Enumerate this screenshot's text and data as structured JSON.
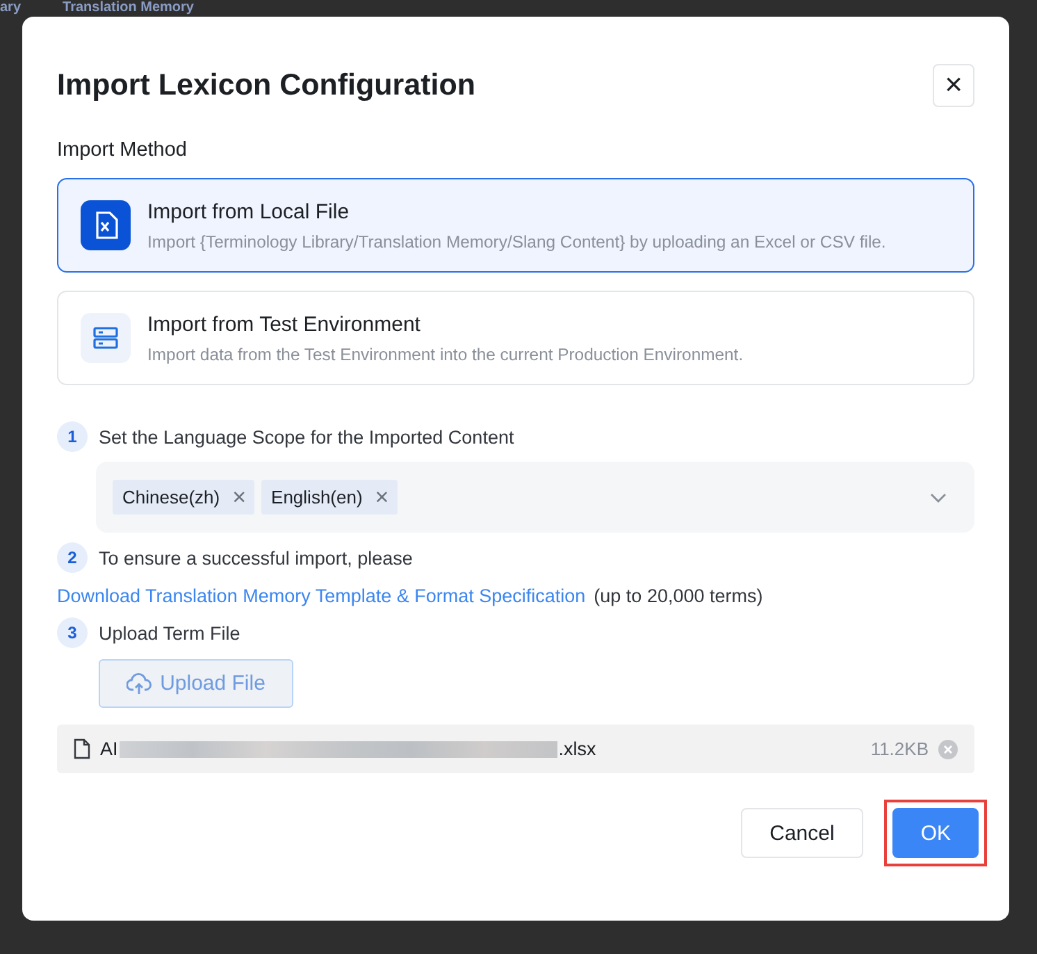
{
  "background_tabs": [
    {
      "label": "ary"
    },
    {
      "label": "Translation Memory"
    }
  ],
  "dialog": {
    "title": "Import Lexicon Configuration",
    "close": "×"
  },
  "import_method": {
    "label": "Import Method",
    "options": [
      {
        "kind": "file",
        "title": "Import from Local File",
        "description": "Import {Terminology Library/Translation Memory/Slang Content} by uploading an Excel or CSV file.",
        "selected": true
      },
      {
        "kind": "server",
        "title": "Import from Test Environment",
        "description": "Import data from the Test Environment into the current Production Environment.",
        "selected": false
      }
    ]
  },
  "steps": [
    {
      "number": "1",
      "text": "Set the Language Scope for the Imported Content"
    },
    {
      "number": "2",
      "text": "To ensure a successful import, please"
    },
    {
      "number": "3",
      "text": "Upload Term File"
    }
  ],
  "language_select": {
    "tags": [
      {
        "label": "Chinese(zh)",
        "remove": "×"
      },
      {
        "label": "English(en)",
        "remove": "×"
      }
    ]
  },
  "template_link": {
    "label": "Download Translation Memory Template & Format Specification",
    "note": "(up to 20,000 terms)"
  },
  "upload_button": {
    "label": "Upload File",
    "disabled": true
  },
  "file": {
    "name_start": "AI",
    "name_end": ".xlsx",
    "size": "11.2KB"
  },
  "buttons": [
    {
      "kind": "secondary",
      "label": "Cancel",
      "highlighted": false
    },
    {
      "kind": "primary",
      "label": "OK",
      "highlighted": true
    }
  ]
}
